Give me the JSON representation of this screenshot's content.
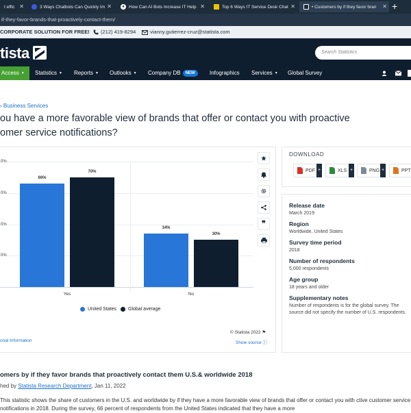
{
  "browser": {
    "tabs": [
      {
        "label": "t effic",
        "active": false
      },
      {
        "label": "3 Ways Chatbots Can Quickly Im",
        "active": false
      },
      {
        "label": "How Can AI Bots Increase IT Help",
        "active": false
      },
      {
        "label": "Top 6 Ways IT Service Desk Chat",
        "active": false
      },
      {
        "label": "• Customers by if they favor bran",
        "active": true
      }
    ],
    "new_tab": "+",
    "address": "if-they-favor-brands-that-proactively-contact-them/"
  },
  "topinfo": {
    "promo": "CORPORATE SOLUTION FOR FREE!",
    "phone": "(212) 419-8294",
    "email": "vianny.gutierrez-cruz@statista.com"
  },
  "header": {
    "logo": "tista",
    "search_placeholder": "Search Statistics"
  },
  "nav": {
    "access": "Access",
    "items": [
      "Statistics",
      "Reports",
      "Outlooks",
      "Company DB",
      "Infographics",
      "Services",
      "Global Survey"
    ],
    "new_badge": "NEW"
  },
  "breadcrumb": "Business Services",
  "title_line1": "ou have a more favorable view of brands that offer or contact you with proactive",
  "title_line2": "omer service notifications?",
  "chart_data": {
    "type": "bar",
    "categories": [
      "Yes",
      "No"
    ],
    "series": [
      {
        "name": "United States",
        "values": [
          66,
          34
        ],
        "color": "#2876d8"
      },
      {
        "name": "Global average",
        "values": [
          70,
          30
        ],
        "color": "#0f1e2e"
      }
    ],
    "data_labels": [
      [
        "66%",
        "34%"
      ],
      [
        "70%",
        "30%"
      ]
    ],
    "ylim": [
      0,
      80
    ],
    "ytick_values": [
      80,
      60,
      40,
      20
    ],
    "ytick_labels": [
      "0%",
      "0%",
      "0%",
      "0%"
    ],
    "legend_position": "bottom",
    "grid": true
  },
  "chart_footer": {
    "copyright": "© Statista 2022",
    "additional_info": "onal Information",
    "show_source": "Show source"
  },
  "tools": [
    "star-icon",
    "bell-icon",
    "gear-icon",
    "share-icon",
    "quote-icon",
    "print-icon"
  ],
  "download": {
    "heading": "DOWNLOAD",
    "formats": [
      {
        "label": "PDF",
        "color": "#d9302c"
      },
      {
        "label": "XLS",
        "color": "#2e8b3e"
      },
      {
        "label": "PNG",
        "color": "#7a8a99"
      },
      {
        "label": "PPT",
        "color": "#e0731f"
      }
    ]
  },
  "meta": [
    {
      "label": "Release date",
      "value": "March 2019"
    },
    {
      "label": "Region",
      "value": "Worldwide, United States"
    },
    {
      "label": "Survey time period",
      "value": "2018"
    },
    {
      "label": "Number of respondents",
      "value": "5,000 respondents"
    },
    {
      "label": "Age group",
      "value": "18 years and older"
    },
    {
      "label": "Supplementary notes",
      "value": "Number of respondents is for the global survey. The source did not specify the number of U.S. respondents."
    }
  ],
  "statistic": {
    "title": "omers by if they favor brands that proactively contact them U.S.& worldwide 2018",
    "published_prefix": "hed by",
    "published_by": "Statista Research Department",
    "published_date": ", Jan 11, 2022",
    "description": "This statistic shows the share of customers in the U.S. and worldwide by if they have a more favorable view of brands that offer or contact you with ctive customer service notifications in 2018. During the survey, 66 percent of respondents from the United States indicated that they have a more"
  }
}
